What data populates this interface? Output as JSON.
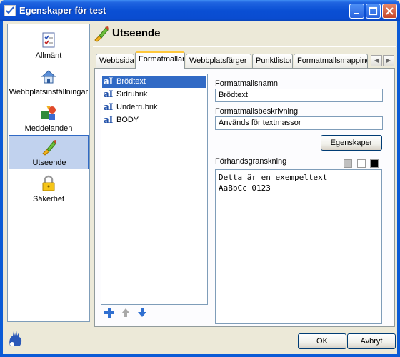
{
  "window": {
    "title": "Egenskaper för test",
    "controls": {
      "minimize": "_",
      "maximize": "□",
      "close": "✕"
    }
  },
  "nav": {
    "items": [
      {
        "label": "Allmänt",
        "icon": "checklist-icon",
        "selected": false
      },
      {
        "label": "Webbplatsinställningar",
        "icon": "house-icon",
        "selected": false
      },
      {
        "label": "Meddelanden",
        "icon": "shapes-icon",
        "selected": false
      },
      {
        "label": "Utseende",
        "icon": "paintbrush-icon",
        "selected": true
      },
      {
        "label": "Säkerhet",
        "icon": "padlock-icon",
        "selected": false
      }
    ]
  },
  "header": {
    "title": "Utseende",
    "icon": "paintbrush-icon"
  },
  "tabs": [
    {
      "label": "Webbsida",
      "active": false
    },
    {
      "label": "Formatmallar",
      "active": true
    },
    {
      "label": "Webbplatsfärger",
      "active": false
    },
    {
      "label": "Punktlistor",
      "active": false
    },
    {
      "label": "Formatmallsmapping",
      "active": false
    }
  ],
  "tab_scroll": {
    "left": "◀",
    "right": "▶"
  },
  "styles_list": {
    "items": [
      {
        "label": "Brödtext",
        "selected": true
      },
      {
        "label": "Sidrubrik",
        "selected": false
      },
      {
        "label": "Underrubrik",
        "selected": false
      },
      {
        "label": "BODY",
        "selected": false
      }
    ],
    "item_icon_glyph": "aI",
    "tools": [
      "plus-icon",
      "arrow-up-icon",
      "arrow-down-icon"
    ]
  },
  "form": {
    "name_label": "Formatmallsnamn",
    "name_value": "Brödtext",
    "desc_label": "Formatmallsbeskrivning",
    "desc_value": "Används för textmassor",
    "properties_button": "Egenskaper",
    "preview_label": "Förhandsgranskning",
    "preview_line1": "Detta är en exempeltext",
    "preview_line2": "AaBbCc 0123",
    "swatches": [
      "#c0c0c0",
      "#ffffff",
      "#000000"
    ]
  },
  "footer": {
    "ok": "OK",
    "cancel": "Avbryt"
  }
}
